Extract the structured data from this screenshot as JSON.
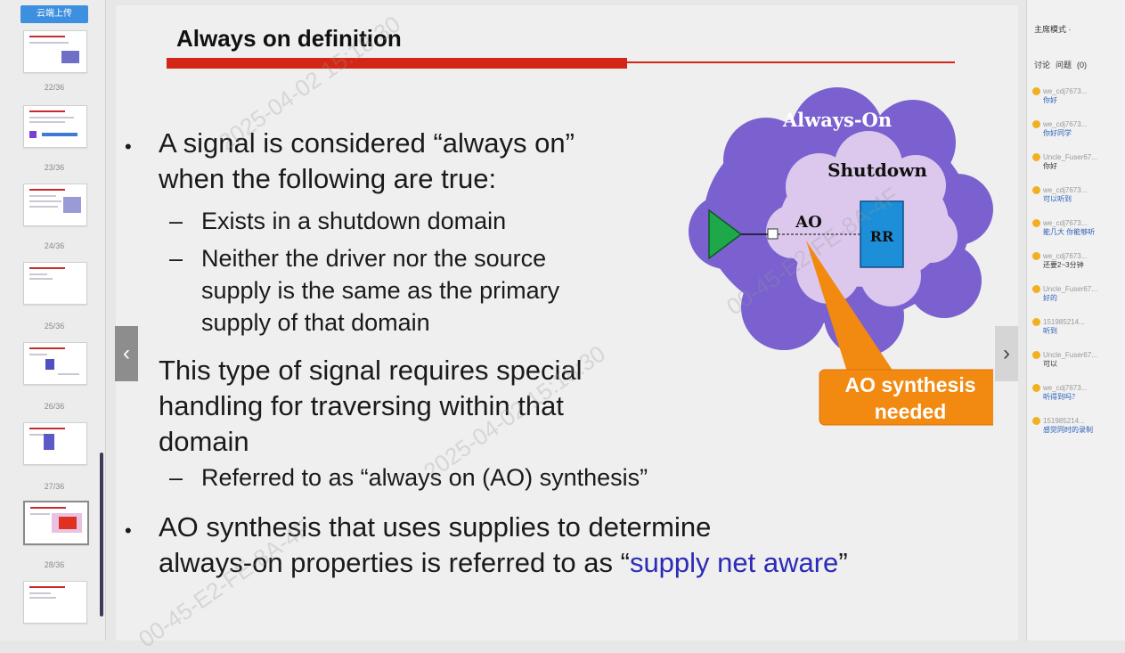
{
  "rail": {
    "upload_label": "云端上传",
    "slide_numbers": [
      "22/36",
      "23/36",
      "24/36",
      "25/36",
      "26/36",
      "27/36",
      "28/36"
    ]
  },
  "slide": {
    "title": "Always on definition",
    "bullets": [
      {
        "lines": [
          "A signal is considered “always on”",
          "when the following are true:"
        ]
      },
      {
        "lines": [
          "This type of signal requires special",
          "handling for traversing within that",
          "domain"
        ]
      },
      {
        "line1": "AO synthesis that uses supplies to determine",
        "line2_pre": "always-on properties is referred to as “",
        "line2_hl": "supply net aware",
        "line2_post": "”"
      }
    ],
    "subs": {
      "s1": "Exists in a shutdown domain",
      "s2": [
        "Neither the driver nor the source",
        "supply is the same as the primary",
        "supply of that domain"
      ],
      "s3": "Referred to as “always on (AO) synthesis”"
    },
    "diagram": {
      "outer_label": "Always-On",
      "inner_label": "Shutdown",
      "ao_label": "AO",
      "rr_label": "RR",
      "callout": [
        "AO synthesis",
        "needed"
      ],
      "colors": {
        "outer_cloud": "#7b60d0",
        "inner_cloud": "#dcc8ec",
        "triangle": "#1fa84a",
        "rr_box": "#1d8fd8",
        "callout": "#f28a12"
      }
    },
    "nav": {
      "prev_icon": "‹",
      "next_icon": "›"
    }
  },
  "chat": {
    "mode": "主席模式 ·",
    "tabs": [
      "讨论",
      "问题",
      "(0)"
    ],
    "messages": [
      {
        "user": "we_cdj7673...",
        "text": "你好"
      },
      {
        "user": "we_cdj7673...",
        "text": "你好同学"
      },
      {
        "user": "Uncle_Fuser67...",
        "text": "你好"
      },
      {
        "user": "we_cdj7673...",
        "text": "可以听到"
      },
      {
        "user": "we_cdj7673...",
        "text": "能几大 你能够听"
      },
      {
        "user": "we_cdj7673...",
        "text": "还要2~3分钟"
      },
      {
        "user": "Uncle_Fuser67...",
        "text": "好的"
      },
      {
        "user": "151985214...",
        "text": "听到"
      },
      {
        "user": "Uncle_Fuser67...",
        "text": "可以"
      },
      {
        "user": "we_cdj7673...",
        "text": "听得到吗？"
      },
      {
        "user": "151985214...",
        "text": "感觉同时的录制"
      }
    ]
  },
  "watermark": {
    "text_a": "2025-04-02 15:18:30",
    "text_b": "00-45-E2-FE-8A-4F"
  }
}
